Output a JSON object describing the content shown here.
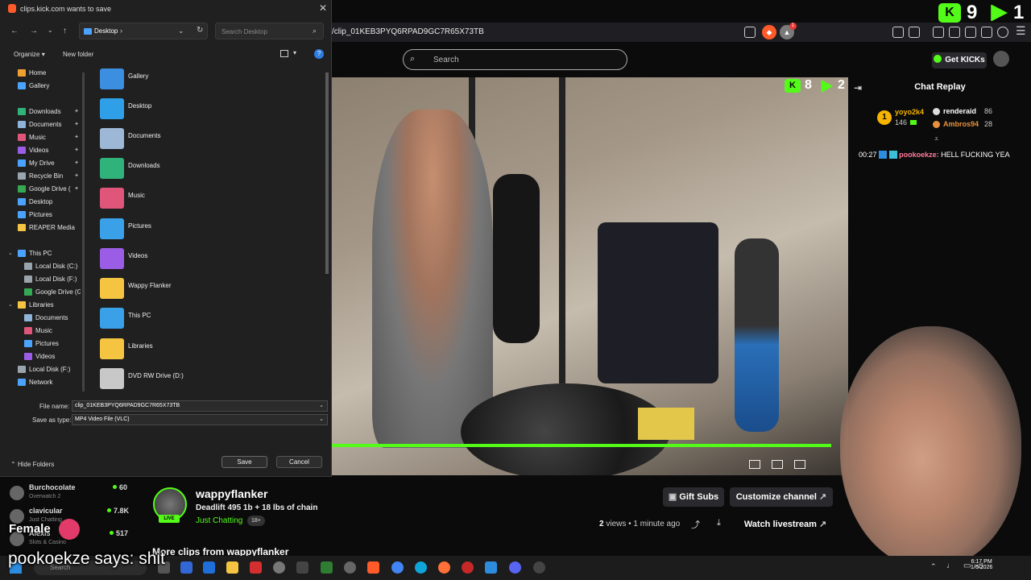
{
  "overlay": {
    "kick_count": "9",
    "play_count": "1",
    "video_kick_count": "8",
    "video_play_count": "2"
  },
  "browser": {
    "url": "/clip_01KEB3PYQ6RPAD9GC7R65X73TB",
    "ext_badge": "1"
  },
  "kick": {
    "search_placeholder": "Search",
    "get_kicks": "Get KICKs",
    "chat_title": "Chat Replay",
    "leaderboard": [
      {
        "rank": "1",
        "name": "yoyo2k4",
        "count": "146"
      },
      {
        "name": "renderaid",
        "count": "86"
      },
      {
        "name": "Ambros94",
        "count": "28"
      }
    ],
    "chat_message": {
      "time": "00:27",
      "user": "pookoekze:",
      "text": "HELL FUCKING YEA"
    },
    "channel": {
      "name": "wappyflanker",
      "title": "Deadlift 495 1b + 18 lbs of chain",
      "category": "Just Chatting",
      "age": "18+",
      "live": "LIVE",
      "more_clips": "More clips from wappyflanker"
    },
    "stats": {
      "views_num": "2",
      "views_label": "views",
      "time_ago": "1 minute ago"
    },
    "buttons": {
      "gift_subs": "Gift Subs",
      "customize": "Customize channel",
      "watch_live": "Watch livestream"
    },
    "sidebar": [
      {
        "name": "Burchocolate",
        "category": "Overwatch 2",
        "count": "60"
      },
      {
        "name": "clavicular",
        "category": "Just Chatting",
        "count": "7.8K"
      },
      {
        "name": "Alexis",
        "category": "Slots & Casino",
        "count": "517"
      }
    ]
  },
  "dialog": {
    "title": "clips.kick.com wants to save",
    "path": "Desktop",
    "search_placeholder": "Search Desktop",
    "organize": "Organize",
    "new_folder": "New folder",
    "nav": [
      {
        "label": "Home",
        "color": "#f0a030"
      },
      {
        "label": "Gallery",
        "color": "#4aa3ff"
      },
      {
        "label": "Downloads",
        "color": "#2fb37a",
        "pinned": true
      },
      {
        "label": "Documents",
        "color": "#8fb4d9",
        "pinned": true
      },
      {
        "label": "Music",
        "color": "#e0567a",
        "pinned": true
      },
      {
        "label": "Videos",
        "color": "#9b5de5",
        "pinned": true
      },
      {
        "label": "My Drive",
        "color": "#4aa3ff",
        "pinned": true
      },
      {
        "label": "Recycle Bin",
        "color": "#9aa4ad",
        "pinned": true
      },
      {
        "label": "Google Drive (",
        "color": "#34a853",
        "pinned": true
      },
      {
        "label": "Desktop",
        "color": "#4aa3ff"
      },
      {
        "label": "Pictures",
        "color": "#4aa3ff"
      },
      {
        "label": "REAPER Media",
        "color": "#f5c542"
      },
      {
        "label": "This PC",
        "color": "#4aa3ff"
      },
      {
        "label": "Local Disk (C:)",
        "color": "#9aa4ad"
      },
      {
        "label": "Local Disk (F:)",
        "color": "#9aa4ad"
      },
      {
        "label": "Google Drive (G",
        "color": "#34a853"
      },
      {
        "label": "Libraries",
        "color": "#f5c542"
      },
      {
        "label": "Documents",
        "color": "#8fb4d9"
      },
      {
        "label": "Music",
        "color": "#e0567a"
      },
      {
        "label": "Pictures",
        "color": "#4aa3ff"
      },
      {
        "label": "Videos",
        "color": "#9b5de5"
      },
      {
        "label": "Local Disk (F:)",
        "color": "#9aa4ad"
      },
      {
        "label": "Network",
        "color": "#4aa3ff"
      }
    ],
    "files": [
      {
        "label": "Gallery",
        "color": "#3b8ee0"
      },
      {
        "label": "Desktop",
        "color": "#2fa0e8"
      },
      {
        "label": "Documents",
        "color": "#9db8d6"
      },
      {
        "label": "Downloads",
        "color": "#2fb37a"
      },
      {
        "label": "Music",
        "color": "#e0567a"
      },
      {
        "label": "Pictures",
        "color": "#3aa0e8"
      },
      {
        "label": "Videos",
        "color": "#9b5de5"
      },
      {
        "label": "Wappy Flanker",
        "color": "#f5c542"
      },
      {
        "label": "This PC",
        "color": "#3aa0e8"
      },
      {
        "label": "Libraries",
        "color": "#f5c542"
      },
      {
        "label": "DVD RW Drive (D:)",
        "color": "#c8c8c8"
      }
    ],
    "file_name_label": "File name:",
    "file_name_value": "clip_01KEB3PYQ6RPAD9GC7R65X73TB",
    "save_type_label": "Save as type:",
    "save_type_value": "MP4 Video File (VLC)",
    "hide_folders": "Hide Folders",
    "save": "Save",
    "cancel": "Cancel"
  },
  "taskbar": {
    "search": "Search",
    "time": "6:17 PM",
    "date": "1/6/2026"
  },
  "captions": {
    "female": "Female",
    "main": "pookoekze says: shit"
  }
}
